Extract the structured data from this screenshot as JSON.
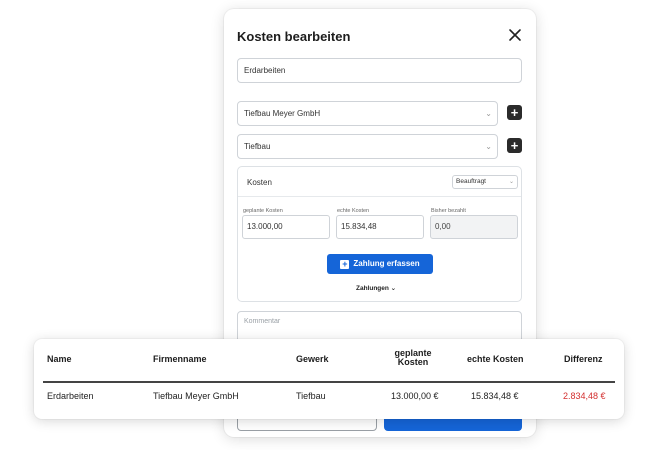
{
  "modal": {
    "title": "Kosten bearbeiten",
    "name_value": "Erdarbeiten",
    "company_value": "Tiefbau Meyer GmbH",
    "trade_value": "Tiefbau",
    "kosten": {
      "label": "Kosten",
      "status_value": "Beauftragt",
      "planned_label": "geplante Kosten",
      "planned_value": "13.000,00",
      "actual_label": "echte Kosten",
      "actual_value": "15.834,48",
      "paid_label": "Bisher bezahlt",
      "paid_value": "0,00",
      "add_payment_label": "Zahlung erfassen",
      "payments_label": "Zahlungen"
    },
    "comment_placeholder": "Kommentar"
  },
  "table": {
    "headers": {
      "name": "Name",
      "company": "Firmenname",
      "trade": "Gewerk",
      "planned": "geplante Kosten",
      "actual": "echte Kosten",
      "difference": "Differenz"
    },
    "row": {
      "name": "Erdarbeiten",
      "company": "Tiefbau Meyer GmbH",
      "trade": "Tiefbau",
      "planned": "13.000,00 €",
      "actual": "15.834,48 €",
      "difference": "2.834,48 €"
    }
  },
  "colors": {
    "primary": "#1565d8",
    "negative": "#d32f2f",
    "dark_button": "#2b2b2b"
  },
  "icons": {
    "close": "close-icon",
    "chevron": "chevron-down-icon",
    "plus": "plus-icon"
  }
}
